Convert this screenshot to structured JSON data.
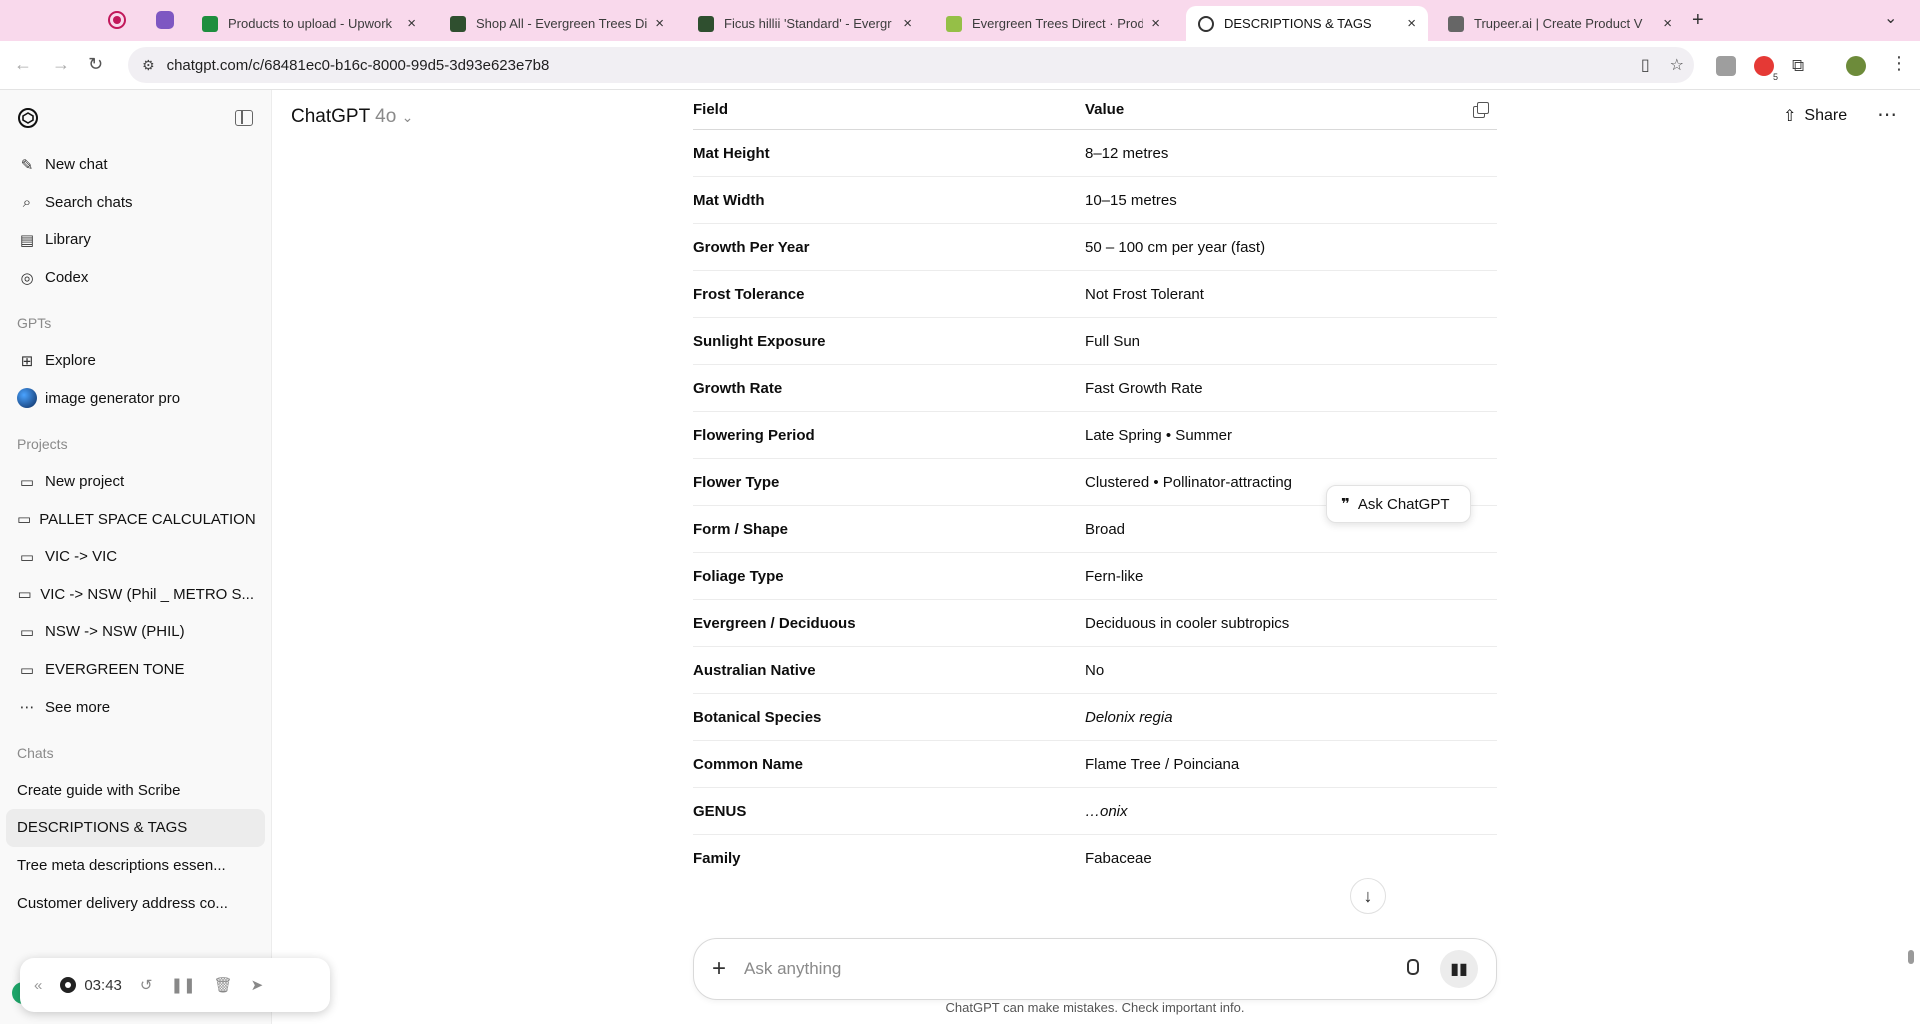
{
  "browser": {
    "tabs": [
      {
        "label": "Products to upload - Upwork",
        "favicon": "sheets-icon"
      },
      {
        "label": "Shop All - Evergreen Trees Di",
        "favicon": "evergreen-icon"
      },
      {
        "label": "Ficus hillii 'Standard' - Evergr",
        "favicon": "evergreen-icon"
      },
      {
        "label": "Evergreen Trees Direct · Prod",
        "favicon": "shopify-icon"
      },
      {
        "label": "DESCRIPTIONS & TAGS",
        "favicon": "chatgpt-icon",
        "active": true
      },
      {
        "label": "Trupeer.ai | Create Product V",
        "favicon": "trupeer-icon"
      }
    ],
    "url": "chatgpt.com/c/68481ec0-b16c-8000-99d5-3d93e623e7b8",
    "extension_badge": "5"
  },
  "sidebar": {
    "top_items": [
      {
        "label": "New chat",
        "icon": "new-chat-icon"
      },
      {
        "label": "Search chats",
        "icon": "search-icon"
      },
      {
        "label": "Library",
        "icon": "library-icon"
      },
      {
        "label": "Codex",
        "icon": "codex-icon"
      }
    ],
    "gpts_heading": "GPTs",
    "gpts": [
      {
        "label": "Explore",
        "icon": "explore-icon"
      },
      {
        "label": "image generator pro",
        "icon": "gpt-avatar"
      }
    ],
    "projects_heading": "Projects",
    "projects": [
      {
        "label": "New project",
        "icon": "new-project-icon"
      },
      {
        "label": "PALLET SPACE CALCULATION",
        "icon": "folder-icon"
      },
      {
        "label": "VIC -> VIC",
        "icon": "folder-icon"
      },
      {
        "label": "VIC -> NSW (Phil _ METRO S...",
        "icon": "folder-icon"
      },
      {
        "label": "NSW -> NSW (PHIL)",
        "icon": "folder-icon"
      },
      {
        "label": "EVERGREEN TONE",
        "icon": "folder-icon"
      },
      {
        "label": "See more",
        "icon": "more-icon"
      }
    ],
    "chats_heading": "Chats",
    "chats": [
      {
        "label": "Create guide with Scribe"
      },
      {
        "label": "DESCRIPTIONS & TAGS",
        "active": true
      },
      {
        "label": "Tree meta descriptions essen..."
      },
      {
        "label": "Customer delivery address co..."
      }
    ]
  },
  "header": {
    "title": "ChatGPT",
    "model": "4o",
    "share_label": "Share"
  },
  "table": {
    "headers": [
      "Field",
      "Value"
    ],
    "rows": [
      {
        "field": "Mat Height",
        "value": "8–12 metres"
      },
      {
        "field": "Mat Width",
        "value": "10–15 metres"
      },
      {
        "field": "Growth Per Year",
        "value": "50 – 100 cm per year (fast)"
      },
      {
        "field": "Frost Tolerance",
        "value": "Not Frost Tolerant"
      },
      {
        "field": "Sunlight Exposure",
        "value": "Full Sun"
      },
      {
        "field": "Growth Rate",
        "value": "Fast Growth Rate"
      },
      {
        "field": "Flowering Period",
        "value": "Late Spring • Summer"
      },
      {
        "field": "Flower Type",
        "value": "Clustered • Pollinator-attracting"
      },
      {
        "field": "Form / Shape",
        "value": "Broad"
      },
      {
        "field": "Foliage Type",
        "value": "Fern-like"
      },
      {
        "field": "Evergreen / Deciduous",
        "value": "Deciduous in cooler subtropics"
      },
      {
        "field": "Australian Native",
        "value": "No"
      },
      {
        "field": "Botanical Species",
        "value": "Delonix regia",
        "italic": true
      },
      {
        "field": "Common Name",
        "value": "Flame Tree / Poinciana"
      },
      {
        "field": "GENUS",
        "value": "…onix",
        "italic": true
      },
      {
        "field": "Family",
        "value": "Fabaceae"
      }
    ]
  },
  "ask_popup": {
    "label": "Ask ChatGPT"
  },
  "composer": {
    "placeholder": "Ask anything"
  },
  "disclaimer": "ChatGPT can make mistakes. Check important info.",
  "recorder": {
    "time": "03:43"
  }
}
